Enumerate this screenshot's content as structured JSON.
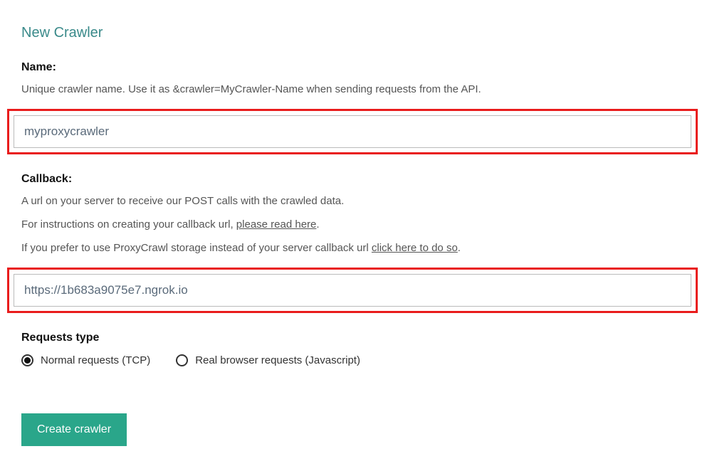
{
  "page": {
    "title": "New Crawler"
  },
  "name_section": {
    "label": "Name:",
    "help": "Unique crawler name. Use it as &crawler=MyCrawler-Name when sending requests from the API.",
    "value": "myproxycrawler"
  },
  "callback_section": {
    "label": "Callback:",
    "help_line1": "A url on your server to receive our POST calls with the crawled data.",
    "help_line2_prefix": "For instructions on creating your callback url, ",
    "help_line2_link": "please read here",
    "help_line2_suffix": ".",
    "help_line3_prefix": "If you prefer to use ProxyCrawl storage instead of your server callback url ",
    "help_line3_link": "click here to do so",
    "help_line3_suffix": ".",
    "value": "https://1b683a9075e7.ngrok.io"
  },
  "requests_type": {
    "label": "Requests type",
    "option_normal": "Normal requests (TCP)",
    "option_browser": "Real browser requests (Javascript)",
    "selected": "normal"
  },
  "submit": {
    "label": "Create crawler"
  },
  "colors": {
    "accent": "#2aa68a",
    "highlight_border": "#e91c1c",
    "title": "#3a8a8a"
  }
}
